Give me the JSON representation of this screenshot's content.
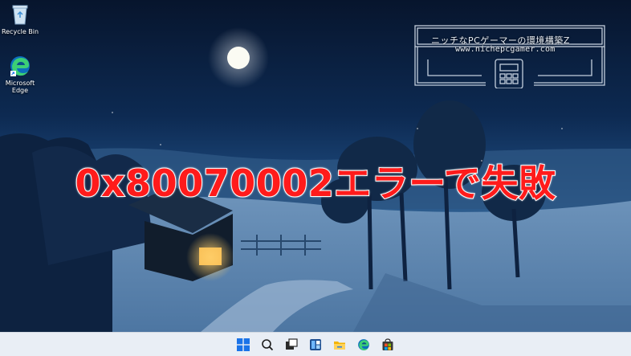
{
  "desktop": {
    "icons": [
      {
        "label": "Recycle Bin"
      },
      {
        "label": "Microsoft\nEdge",
        "label_line1": "Microsoft",
        "label_line2": "Edge"
      }
    ]
  },
  "watermark": {
    "title": "ニッチなPCゲーマーの環境構築Z",
    "url": "www.nichepcgamer.com"
  },
  "headline": {
    "text": "0x80070002エラーで失敗"
  },
  "taskbar": {
    "items": [
      {
        "icon": "windows-start-icon"
      },
      {
        "icon": "search-icon"
      },
      {
        "icon": "task-view-icon"
      },
      {
        "icon": "widgets-icon"
      },
      {
        "icon": "file-explorer-icon"
      },
      {
        "icon": "edge-icon"
      },
      {
        "icon": "microsoft-store-icon"
      }
    ]
  },
  "colors": {
    "headline": "#ff1b1b",
    "headline_outline": "#ffffff",
    "taskbar_bg": "#e9eef5",
    "start_blue": "#1a73e8"
  }
}
